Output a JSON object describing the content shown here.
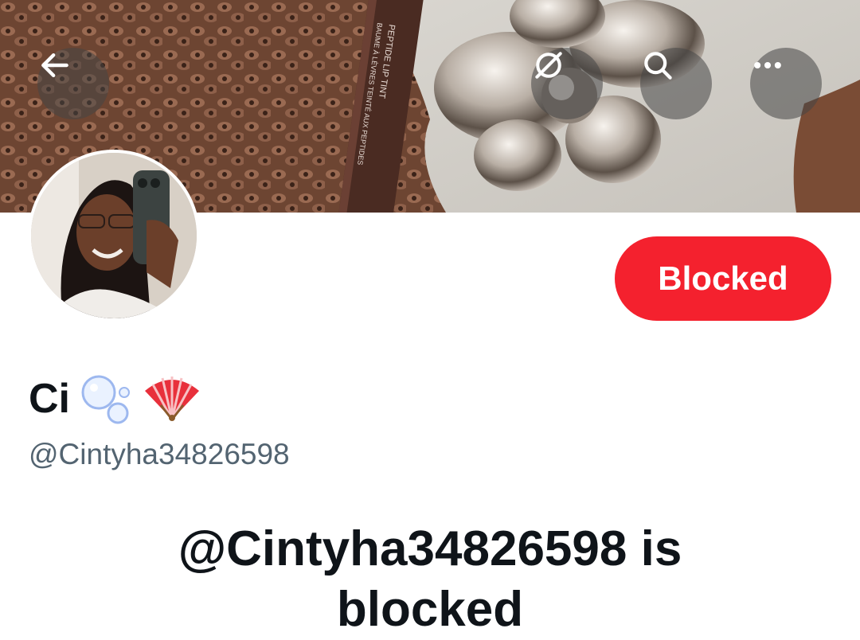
{
  "header": {
    "back_icon": "arrow-left-icon",
    "grok_icon": "grok-icon",
    "search_icon": "search-icon",
    "more_icon": "more-icon"
  },
  "profile": {
    "display_name": "Ci",
    "name_emojis": [
      "bubbles-emoji",
      "folding-fan-emoji"
    ],
    "handle": "@Cintyha34826598",
    "follow_state_label": "Blocked"
  },
  "blocked_notice": {
    "title_line1": "@Cintyha34826598 is",
    "title_line2": "blocked"
  },
  "banner": {
    "product_text_1": "PEPTIDE LIP TINT",
    "product_text_2": "BAUME À LÈVRES TEINTÉ AUX PEPTIDES"
  },
  "colors": {
    "blocked_red": "#f4212e",
    "text_primary": "#0f1419",
    "text_secondary": "#536471"
  }
}
